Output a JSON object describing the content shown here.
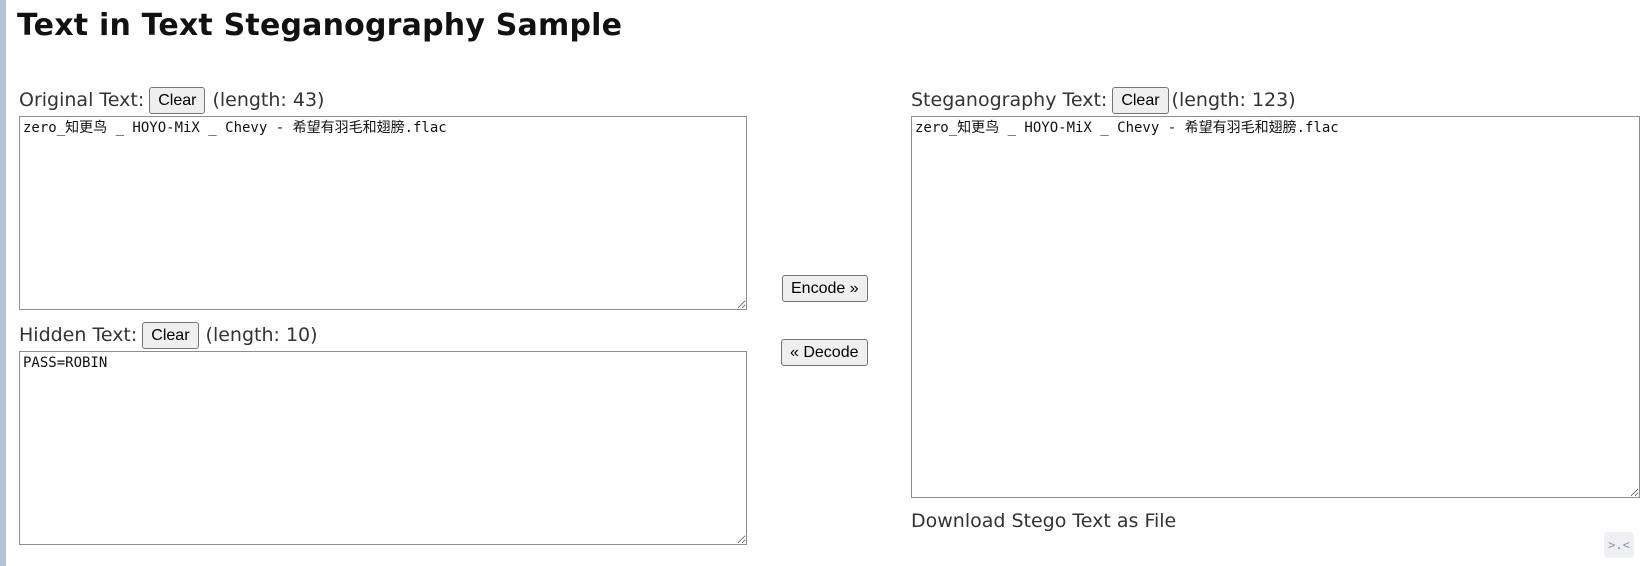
{
  "page": {
    "title": "Text in Text Steganography Sample"
  },
  "original": {
    "label": "Original Text:",
    "clear_label": "Clear",
    "length_text": "(length: 43)",
    "value": "zero_知更鸟 _ HOYO-MiX _ Chevy - 希望有羽毛和翅膀.flac"
  },
  "hidden": {
    "label": "Hidden Text:",
    "clear_label": "Clear",
    "length_text": "(length: 10)",
    "value": "PASS=ROBIN"
  },
  "stego": {
    "label": "Steganography Text:",
    "clear_label": "Clear",
    "length_text": "(length: 123)",
    "value": "zero_知更鸟 _ HOYO-MiX _ Chevy - 希望有羽毛和翅膀.flac"
  },
  "actions": {
    "encode_label": "Encode »",
    "decode_label": "« Decode",
    "download_label": "Download Stego Text as File"
  },
  "corner": {
    "icon": "sleepy-face-icon",
    "glyph": ">.<"
  }
}
